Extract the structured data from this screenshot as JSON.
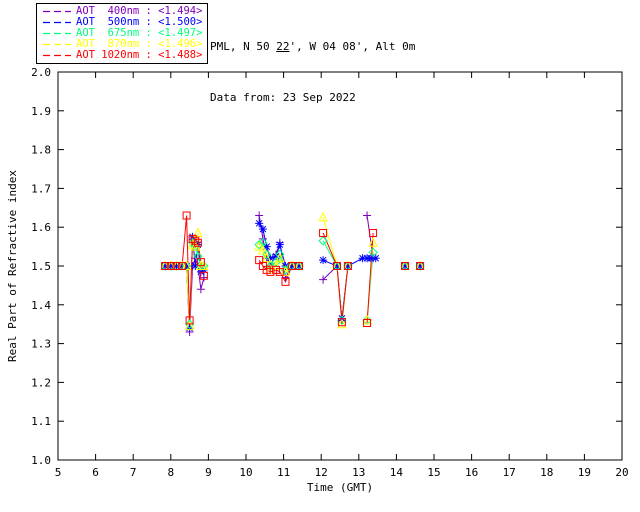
{
  "header": {
    "title_prefix": "PML, N 50 ",
    "title_lat_min": "22",
    "title_suffix": "', W 04 08', Alt 0m",
    "subtitle": "Data from: 23 Sep 2022"
  },
  "chart_data": {
    "type": "line",
    "title": "",
    "xlabel": "Time (GMT)",
    "ylabel": "Real Part of Refractive index",
    "xlim": [
      5,
      20
    ],
    "ylim": [
      1.0,
      2.0
    ],
    "x_ticks": [
      5,
      6,
      7,
      8,
      9,
      10,
      11,
      12,
      13,
      14,
      15,
      16,
      17,
      18,
      19,
      20
    ],
    "y_ticks": [
      "1.0",
      "1.1",
      "1.2",
      "1.3",
      "1.4",
      "1.5",
      "1.6",
      "1.7",
      "1.8",
      "1.9",
      "2.0"
    ],
    "grid": false,
    "legend_position": "top-left-outside",
    "line_gap_hours": 0.39,
    "axis_color": "#000000",
    "background_color": "#ffffff",
    "series": [
      {
        "name": "AOT 400nm",
        "legend_label": "AOT  400nm : <1.494>",
        "mean_value": "<1.494>",
        "color": "#8000C0",
        "marker": "plus",
        "points": [
          [
            7.85,
            1.5
          ],
          [
            8.0,
            1.5
          ],
          [
            8.15,
            1.5
          ],
          [
            8.3,
            1.5
          ],
          [
            8.42,
            1.5
          ],
          [
            8.5,
            1.33
          ],
          [
            8.58,
            1.5
          ],
          [
            8.65,
            1.52
          ],
          [
            8.72,
            1.5
          ],
          [
            8.8,
            1.44
          ],
          [
            8.88,
            1.47
          ],
          [
            10.35,
            1.63
          ],
          [
            10.45,
            1.57
          ],
          [
            10.55,
            1.52
          ],
          [
            10.65,
            1.5
          ],
          [
            10.8,
            1.53
          ],
          [
            10.9,
            1.56
          ],
          [
            11.05,
            1.47
          ],
          [
            11.22,
            1.5
          ],
          [
            11.41,
            1.5
          ],
          [
            12.05,
            1.465
          ],
          [
            12.42,
            1.5
          ],
          [
            12.55,
            1.36
          ],
          [
            12.71,
            1.5
          ],
          [
            13.22,
            1.63
          ],
          [
            13.38,
            1.52
          ],
          [
            14.23,
            1.5
          ],
          [
            14.63,
            1.5
          ]
        ]
      },
      {
        "name": "AOT 500nm",
        "legend_label": "AOT  500nm : <1.500>",
        "mean_value": "<1.500>",
        "color": "#0000FF",
        "marker": "asterisk",
        "points": [
          [
            7.85,
            1.5
          ],
          [
            8.0,
            1.5
          ],
          [
            8.15,
            1.5
          ],
          [
            8.3,
            1.5
          ],
          [
            8.42,
            1.5
          ],
          [
            8.5,
            1.34
          ],
          [
            8.58,
            1.575
          ],
          [
            8.65,
            1.5
          ],
          [
            8.72,
            1.555
          ],
          [
            8.8,
            1.485
          ],
          [
            8.88,
            1.49
          ],
          [
            10.35,
            1.61
          ],
          [
            10.45,
            1.595
          ],
          [
            10.55,
            1.55
          ],
          [
            10.65,
            1.52
          ],
          [
            10.8,
            1.525
          ],
          [
            10.9,
            1.555
          ],
          [
            11.05,
            1.5
          ],
          [
            11.22,
            1.5
          ],
          [
            11.41,
            1.5
          ],
          [
            12.05,
            1.515
          ],
          [
            12.42,
            1.5
          ],
          [
            12.55,
            1.365
          ],
          [
            12.71,
            1.5
          ],
          [
            13.1,
            1.52
          ],
          [
            13.22,
            1.52
          ],
          [
            13.32,
            1.52
          ],
          [
            13.45,
            1.52
          ],
          [
            14.23,
            1.5
          ],
          [
            14.63,
            1.5
          ]
        ]
      },
      {
        "name": "AOT 675nm",
        "legend_label": "AOT  675nm : <1.497>",
        "mean_value": "<1.497>",
        "color": "#00FF80",
        "marker": "diamond",
        "points": [
          [
            7.85,
            1.5
          ],
          [
            8.0,
            1.5
          ],
          [
            8.15,
            1.5
          ],
          [
            8.3,
            1.5
          ],
          [
            8.42,
            1.5
          ],
          [
            8.5,
            1.35
          ],
          [
            8.58,
            1.56
          ],
          [
            8.65,
            1.55
          ],
          [
            8.72,
            1.525
          ],
          [
            8.8,
            1.5
          ],
          [
            8.88,
            1.5
          ],
          [
            10.35,
            1.555
          ],
          [
            10.45,
            1.56
          ],
          [
            10.55,
            1.53
          ],
          [
            10.65,
            1.5
          ],
          [
            10.8,
            1.51
          ],
          [
            10.9,
            1.53
          ],
          [
            11.05,
            1.49
          ],
          [
            11.22,
            1.5
          ],
          [
            11.41,
            1.5
          ],
          [
            12.05,
            1.565
          ],
          [
            12.42,
            1.5
          ],
          [
            12.55,
            1.36
          ],
          [
            12.71,
            1.5
          ],
          [
            13.22,
            1.36
          ],
          [
            13.38,
            1.535
          ],
          [
            14.23,
            1.5
          ],
          [
            14.63,
            1.5
          ]
        ]
      },
      {
        "name": "AOT 870nm",
        "legend_label": "AOT  870nm : <1.496>",
        "mean_value": "<1.496>",
        "color": "#FFFF00",
        "marker": "triangle",
        "points": [
          [
            7.85,
            1.5
          ],
          [
            8.0,
            1.5
          ],
          [
            8.15,
            1.5
          ],
          [
            8.3,
            1.5
          ],
          [
            8.42,
            1.5
          ],
          [
            8.5,
            1.345
          ],
          [
            8.58,
            1.555
          ],
          [
            8.65,
            1.55
          ],
          [
            8.72,
            1.585
          ],
          [
            8.8,
            1.5
          ],
          [
            8.88,
            1.5
          ],
          [
            10.35,
            1.55
          ],
          [
            10.45,
            1.54
          ],
          [
            10.55,
            1.52
          ],
          [
            10.65,
            1.49
          ],
          [
            10.8,
            1.5
          ],
          [
            10.9,
            1.52
          ],
          [
            11.05,
            1.485
          ],
          [
            11.22,
            1.5
          ],
          [
            11.41,
            1.5
          ],
          [
            12.05,
            1.625
          ],
          [
            12.42,
            1.5
          ],
          [
            12.55,
            1.35
          ],
          [
            12.71,
            1.5
          ],
          [
            13.22,
            1.36
          ],
          [
            13.38,
            1.56
          ],
          [
            14.23,
            1.5
          ],
          [
            14.63,
            1.5
          ]
        ]
      },
      {
        "name": "AOT 1020nm",
        "legend_label": "AOT 1020nm : <1.488>",
        "mean_value": "<1.488>",
        "color": "#FF0000",
        "marker": "square",
        "points": [
          [
            7.85,
            1.5
          ],
          [
            8.0,
            1.5
          ],
          [
            8.15,
            1.5
          ],
          [
            8.3,
            1.5
          ],
          [
            8.42,
            1.63
          ],
          [
            8.5,
            1.36
          ],
          [
            8.58,
            1.57
          ],
          [
            8.65,
            1.565
          ],
          [
            8.72,
            1.56
          ],
          [
            8.8,
            1.51
          ],
          [
            8.88,
            1.475
          ],
          [
            10.35,
            1.515
          ],
          [
            10.45,
            1.5
          ],
          [
            10.55,
            1.49
          ],
          [
            10.65,
            1.485
          ],
          [
            10.8,
            1.49
          ],
          [
            10.9,
            1.485
          ],
          [
            11.05,
            1.459
          ],
          [
            11.22,
            1.5
          ],
          [
            11.41,
            1.5
          ],
          [
            12.05,
            1.585
          ],
          [
            12.42,
            1.5
          ],
          [
            12.55,
            1.355
          ],
          [
            12.71,
            1.5
          ],
          [
            13.22,
            1.353
          ],
          [
            13.38,
            1.585
          ],
          [
            14.23,
            1.5
          ],
          [
            14.63,
            1.5
          ]
        ]
      }
    ]
  }
}
